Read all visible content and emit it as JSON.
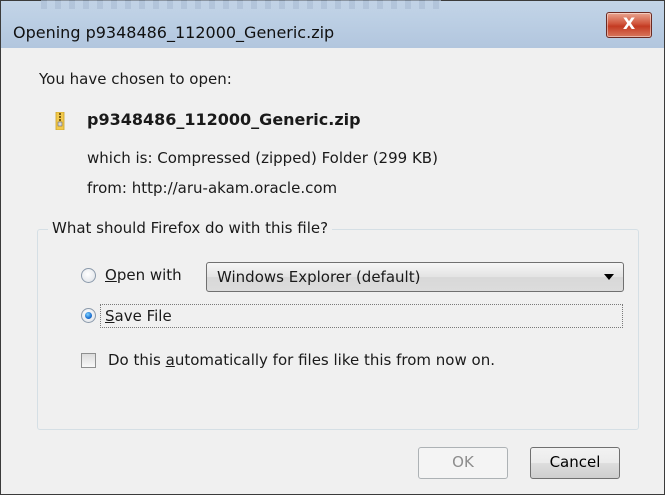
{
  "window": {
    "title": "Opening p9348486_112000_Generic.zip",
    "close_glyph": "X"
  },
  "dialog": {
    "chosen_text": "You have chosen to open:",
    "file_icon": "zip-folder-icon",
    "file_name": "p9348486_112000_Generic.zip",
    "which_is": "which is: Compressed (zipped) Folder (299 KB)",
    "from": "from: http://aru-akam.oracle.com"
  },
  "action_group": {
    "legend": "What should Firefox do with this file?",
    "open_with": {
      "label_prefix": "",
      "label_accel": "O",
      "label_rest": "pen with",
      "selected": false,
      "app": "Windows Explorer (default)"
    },
    "save_file": {
      "label_accel": "S",
      "label_rest": "ave File",
      "selected": true
    },
    "auto": {
      "label_pre": "Do this ",
      "label_accel": "a",
      "label_post": "utomatically for files like this from now on.",
      "checked": false
    }
  },
  "buttons": {
    "ok_label": "OK",
    "ok_enabled": false,
    "cancel_label": "Cancel"
  },
  "colors": {
    "title_bar": "#bccfe4",
    "close_button": "#c43a22",
    "dialog_bg": "#f0f0f0",
    "radio_selected": "#1a6fd1"
  }
}
